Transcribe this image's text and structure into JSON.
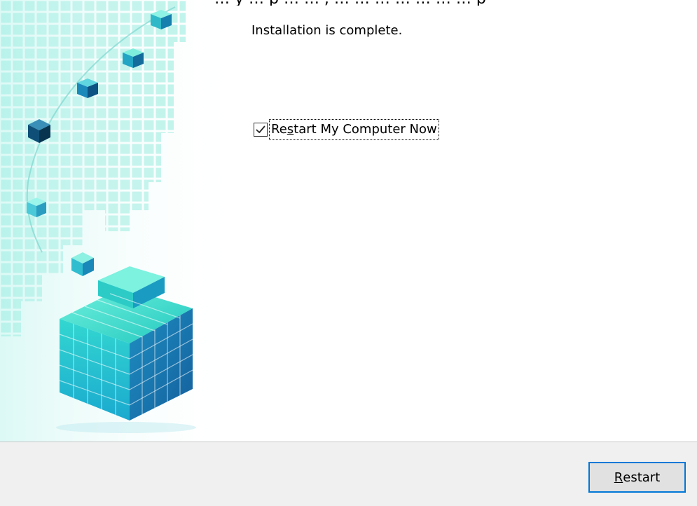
{
  "top_cut_text": "_ … y … p … … , … … … … … … … p",
  "dialog": {
    "message": "Installation is complete.",
    "checkbox": {
      "label_before": "Re",
      "label_mnemonic": "s",
      "label_after": "tart My Computer Now",
      "checked": true
    }
  },
  "footer": {
    "restart_button": {
      "mnemonic": "R",
      "label_after": "estart"
    }
  },
  "colors": {
    "accent": "#0078d7",
    "footer_bg": "#f0f0f0",
    "art_cyan": "#2fd6c3",
    "art_blue": "#1f9fd6"
  },
  "icons": {
    "checkbox_mark": "checkmark-icon",
    "side_art": "cube-graphic"
  }
}
